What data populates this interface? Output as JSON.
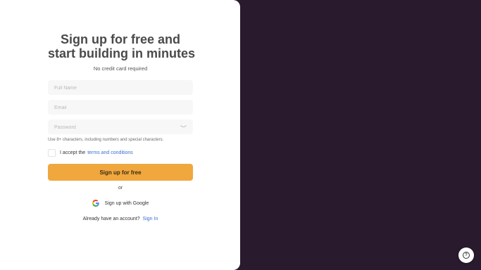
{
  "signup": {
    "title_line1": "Sign up for free and",
    "title_line2": "start building in minutes",
    "subtitle": "No credit card required",
    "full_name_placeholder": "Full Name",
    "email_placeholder": "Email",
    "password_placeholder": "Password",
    "password_hint": "Use 8+ characters, including numbers and special characters.",
    "accept_text": "I accept the",
    "terms_link": "terms and conditions",
    "submit_label": "Sign up for free",
    "or_text": "or",
    "google_label": "Sign up with Google",
    "have_account_text": "Already have an account?",
    "signin_link": "Sign In"
  },
  "icons": {
    "password_toggle": "eye-icon",
    "google": "google-icon",
    "help": "help-icon"
  },
  "colors": {
    "background": "#2a1a2e",
    "primary_button": "#f0a73e",
    "link": "#3b6fd4"
  }
}
